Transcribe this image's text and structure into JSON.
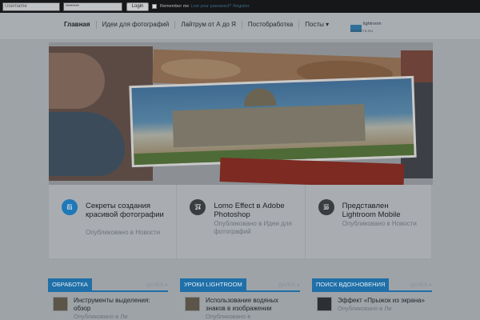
{
  "topbar": {
    "username_value": "Username",
    "password_value": "••••••••",
    "login_label": "Login",
    "remember_label": "Remember me",
    "lost_password_label": "Lost your password?",
    "register_label": "Register"
  },
  "nav": {
    "items": [
      {
        "label": "Главная"
      },
      {
        "label": "Идеи для фотографий"
      },
      {
        "label": "Лайтрум от А до Я"
      },
      {
        "label": "Постобработка"
      },
      {
        "label": "Посты ▾"
      }
    ]
  },
  "logo": {
    "text": "lightroom",
    "sub": "PRESETS.RU"
  },
  "posts": [
    {
      "month": "дек",
      "day": "03",
      "title": "Секреты создания красивой фотографии",
      "meta": "Опубликовано в Новости"
    },
    {
      "month": "фев",
      "day": "24",
      "title": "Lomo Effect в Adobe Photoshop",
      "meta": "Опубликовано в Идеи для фотографий"
    },
    {
      "month": "сен",
      "day": "30",
      "title": "Представлен Lightroom Mobile",
      "meta": "Опубликовано в Новости"
    }
  ],
  "categories": [
    {
      "tag": "ОБРАБОТКА",
      "more": "ДАЛЕЕ ▸",
      "post_title": "Инструменты выделения: обзор",
      "post_meta": "Опубликовано в Ли"
    },
    {
      "tag": "УРОКИ LIGHTROOM",
      "more": "ДАЛЕЕ ▸",
      "post_title": "Использование водяных знаков в изображении",
      "post_meta": "Опубликовано в"
    },
    {
      "tag": "ПОИСК ВДОХНОВЕНИЯ",
      "more": "ДАЛЕЕ ▸",
      "post_title": "Эффект «Прыжок из экрана»",
      "post_meta": "Опубликовано в Ли"
    }
  ]
}
